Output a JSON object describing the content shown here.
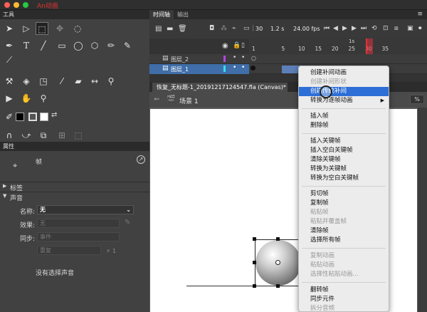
{
  "window": {
    "title": "An动画"
  },
  "tools_panel": {
    "title": "工具"
  },
  "properties": {
    "title": "属性",
    "frame_label": "帧",
    "label_section": "标签",
    "sound_section": "声音",
    "name_label": "名称:",
    "name_value": "无",
    "effect_label": "效果:",
    "effect_value": "无",
    "sync_label": "同步:",
    "sync_value": "事件",
    "repeat_value": "重复",
    "repeat_count": "1",
    "no_sound": "没有选择声音"
  },
  "timeline": {
    "tabs": [
      "时间轴",
      "输出"
    ],
    "frame": "30",
    "fps_speed": "1.2 s",
    "fps": "24.00 fps",
    "ruler_marks": [
      "1s"
    ],
    "frame_numbers": [
      "1",
      "5",
      "10",
      "15",
      "20",
      "25",
      "30",
      "35"
    ],
    "layers": [
      {
        "name": "图层_2",
        "selected": false
      },
      {
        "name": "图层_1",
        "selected": true
      }
    ]
  },
  "document": {
    "tab": "恢复_无标题-1_20191217124547.fla (Canvas)*",
    "scene": "场景 1",
    "zoom": "%"
  },
  "context_menu": {
    "items": [
      {
        "label": "创建补间动画",
        "state": "normal"
      },
      {
        "label": "创建补间形状",
        "state": "disabled"
      },
      {
        "label": "创建传统补间",
        "state": "highlighted"
      },
      {
        "label": "转换为逐帧动画",
        "state": "submenu"
      },
      {
        "label": "插入帧",
        "state": "normal"
      },
      {
        "label": "删除帧",
        "state": "normal"
      },
      {
        "label": "插入关键帧",
        "state": "normal"
      },
      {
        "label": "插入空白关键帧",
        "state": "normal"
      },
      {
        "label": "清除关键帧",
        "state": "normal"
      },
      {
        "label": "转换为关键帧",
        "state": "normal"
      },
      {
        "label": "转换为空白关键帧",
        "state": "normal"
      },
      {
        "label": "剪切帧",
        "state": "normal"
      },
      {
        "label": "复制帧",
        "state": "normal"
      },
      {
        "label": "粘贴帧",
        "state": "disabled"
      },
      {
        "label": "粘贴并覆盖帧",
        "state": "disabled"
      },
      {
        "label": "清除帧",
        "state": "normal"
      },
      {
        "label": "选择所有帧",
        "state": "normal"
      },
      {
        "label": "复制动画",
        "state": "disabled"
      },
      {
        "label": "粘贴动画",
        "state": "disabled"
      },
      {
        "label": "选择性粘贴动画...",
        "state": "disabled"
      },
      {
        "label": "翻转帧",
        "state": "normal"
      },
      {
        "label": "同步元件",
        "state": "normal"
      },
      {
        "label": "拆分音频",
        "state": "disabled"
      }
    ]
  },
  "colors": {
    "accent": "#2d6fd6",
    "playhead": "#e0303a"
  }
}
